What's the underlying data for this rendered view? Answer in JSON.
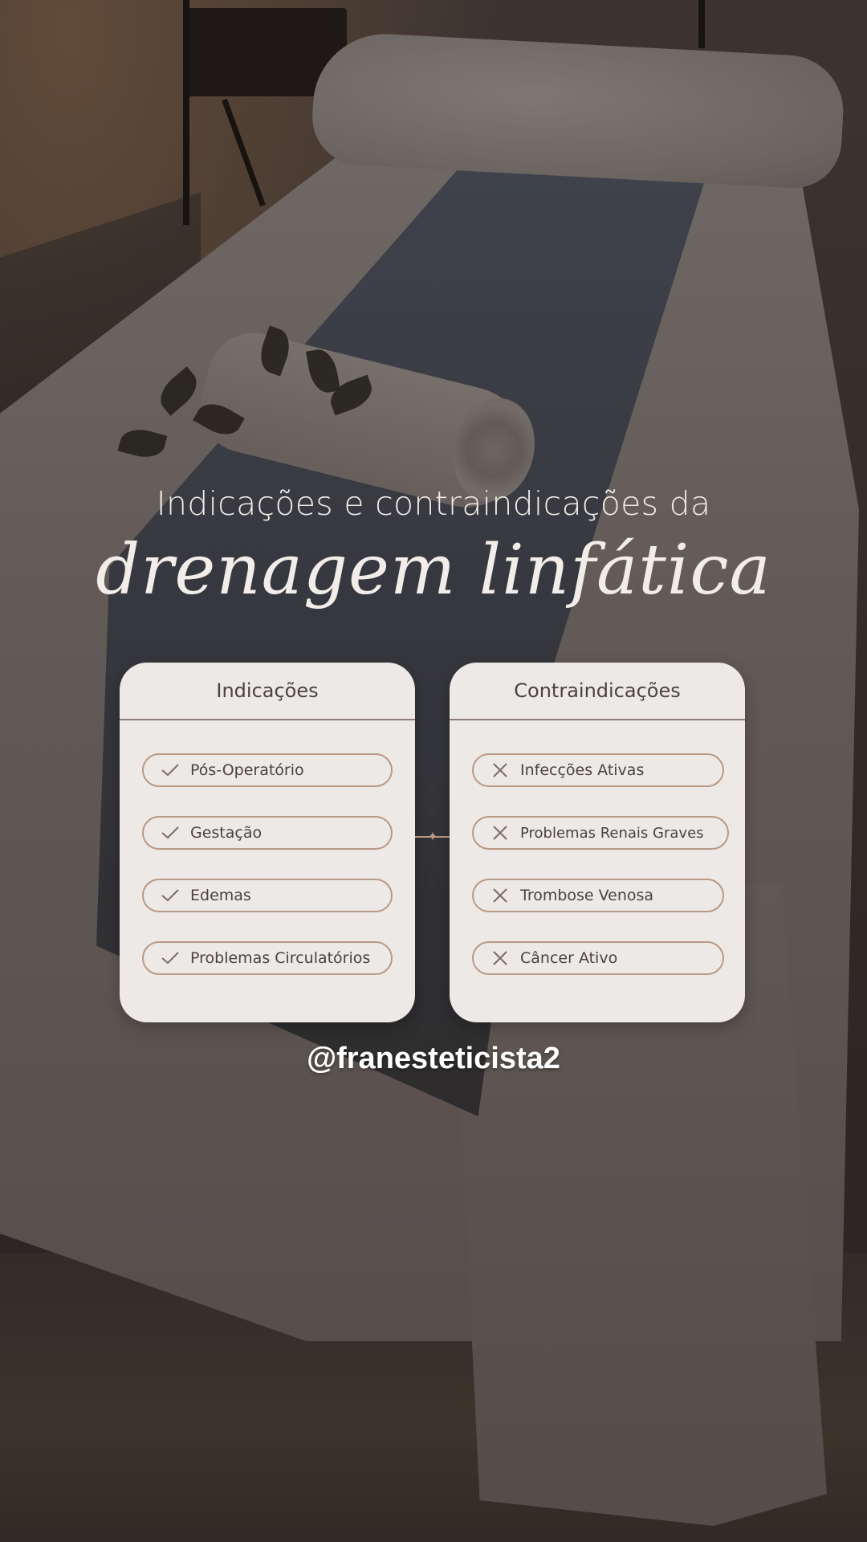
{
  "title": {
    "line1": "Indicações e contraindicações da",
    "line2": "drenagem linfática"
  },
  "indications": {
    "header": "Indicações",
    "icon": "check-icon",
    "items": [
      "Pós-Operatório",
      "Gestação",
      "Edemas",
      "Problemas Circulatórios"
    ]
  },
  "contraindications": {
    "header": "Contraindicações",
    "icon": "x-icon",
    "items": [
      "Infecções Ativas",
      "Problemas Renais Graves",
      "Trombose Venosa",
      "Câncer Ativo"
    ]
  },
  "handle": "@franesteticista2",
  "colors": {
    "card_bg": "#ede9e6",
    "accent": "#b89a86",
    "text_dark": "#4a4340",
    "title_text": "#f2ede8"
  }
}
